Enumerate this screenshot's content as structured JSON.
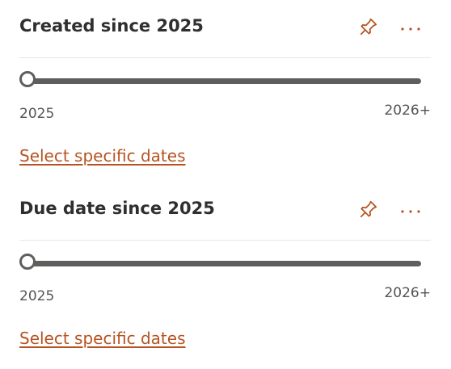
{
  "accent_color": "#b75321",
  "filters": [
    {
      "title": "Created since 2025",
      "pin_icon": "pin-icon",
      "more_icon": "more-options-icon",
      "range_min_label": "2025",
      "range_max_label": "2026+",
      "selected_value": "2025",
      "link_label": "Select specific dates"
    },
    {
      "title": "Due date since 2025",
      "pin_icon": "pin-icon",
      "more_icon": "more-options-icon",
      "range_min_label": "2025",
      "range_max_label": "2026+",
      "selected_value": "2025",
      "link_label": "Select specific dates"
    }
  ]
}
